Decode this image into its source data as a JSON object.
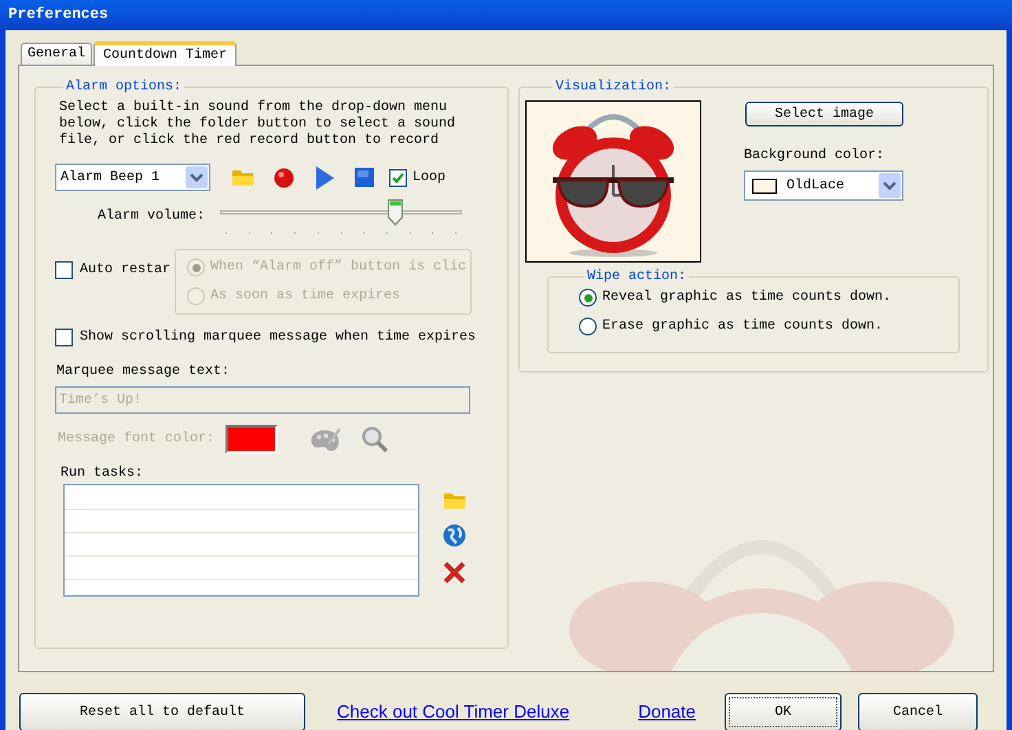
{
  "window": {
    "title": "Preferences"
  },
  "tabs": [
    {
      "label": "General",
      "selected": false
    },
    {
      "label": "Countdown Timer",
      "selected": true
    }
  ],
  "alarm_options": {
    "legend": "Alarm options:",
    "instructions": "Select a built-in sound from the drop-down menu below, click the folder button to select a sound file, or click the red record button to record",
    "sound": {
      "value": "Alarm Beep 1"
    },
    "loop": {
      "label": "Loop",
      "checked": true
    },
    "volume": {
      "label": "Alarm volume:",
      "level": 0.74
    },
    "auto_restart": {
      "label": "Auto restar",
      "checked": false,
      "options": [
        {
          "label": "When “Alarm off” button is clic",
          "selected": true,
          "disabled": true
        },
        {
          "label": "As soon as time expires",
          "selected": false,
          "disabled": true
        }
      ]
    },
    "marquee": {
      "label": "Show scrolling marquee message when time expires",
      "checked": false
    },
    "marquee_text": {
      "label": "Marquee message text:",
      "value": "Time’s Up!",
      "disabled": true
    },
    "font_color": {
      "label": "Message font color:",
      "color": "#ff0000",
      "disabled": true
    },
    "run_tasks": {
      "label": "Run tasks:"
    }
  },
  "visualization": {
    "legend": "Visualization:",
    "select_image": "Select image",
    "background_color": {
      "label": "Background color:",
      "value": "OldLace",
      "color": "#fdf5e6"
    },
    "wipe_action": {
      "legend": "Wipe action:",
      "options": [
        {
          "label": "Reveal graphic as time counts down.",
          "selected": true
        },
        {
          "label": "Erase graphic as time counts down.",
          "selected": false
        }
      ]
    }
  },
  "buttons": {
    "reset": "Reset all to default",
    "promo_link": "Check out Cool Timer Deluxe",
    "donate_link": "Donate",
    "ok": "OK",
    "cancel": "Cancel"
  }
}
